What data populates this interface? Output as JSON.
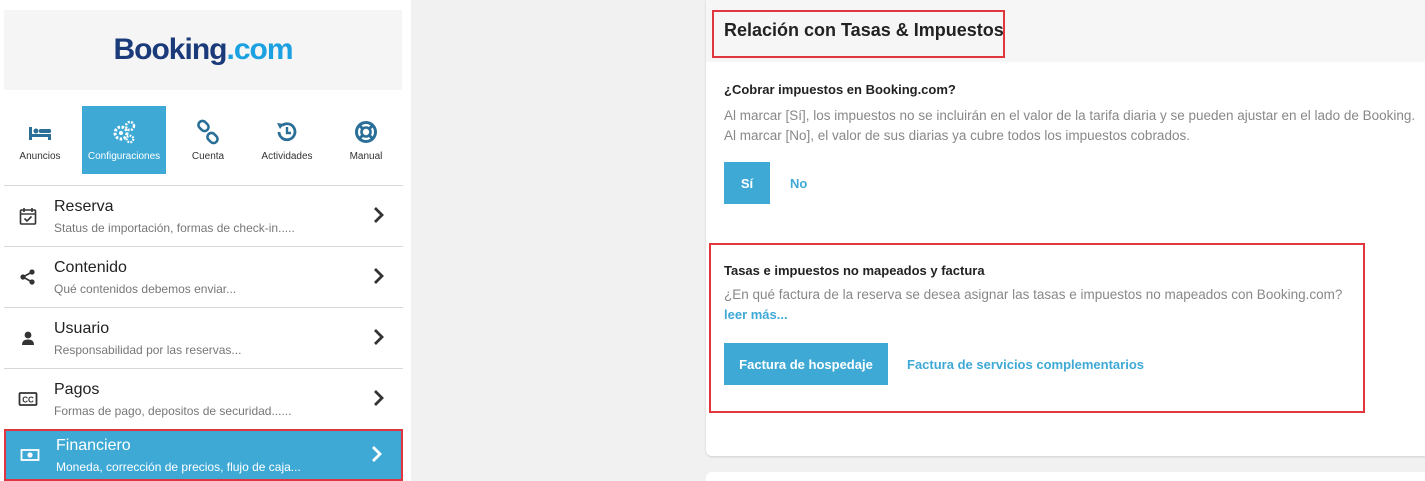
{
  "logo": {
    "brand": "Booking",
    "suffix": ".com"
  },
  "iconbar": [
    {
      "label": "Anuncios",
      "icon": "bed-icon"
    },
    {
      "label": "Configuraciones",
      "icon": "gears-icon"
    },
    {
      "label": "Cuenta",
      "icon": "link-icon"
    },
    {
      "label": "Actividades",
      "icon": "history-icon"
    },
    {
      "label": "Manual",
      "icon": "lifebuoy-icon"
    }
  ],
  "menu": [
    {
      "title": "Reserva",
      "subtitle": "Status de importación, formas de check-in.....",
      "icon": "calendar-check-icon"
    },
    {
      "title": "Contenido",
      "subtitle": "Qué contenidos debemos enviar...",
      "icon": "share-icon"
    },
    {
      "title": "Usuario",
      "subtitle": "Responsabilidad por las reservas...",
      "icon": "user-icon"
    },
    {
      "title": "Pagos",
      "subtitle": "Formas de pago, depositos de securidad......",
      "icon": "cc-icon"
    },
    {
      "title": "Financiero",
      "subtitle": "Moneda, corrección de precios, flujo de caja...",
      "icon": "money-icon"
    }
  ],
  "panel": {
    "title": "Relación con Tasas & Impuestos",
    "section1": {
      "question": "¿Cobrar impuestos en Booking.com?",
      "desc_line1": "Al marcar [Sí], los impuestos no se incluirán en el valor de la tarifa diaria y se pueden ajustar en el lado de Booking.",
      "desc_line2": "Al marcar [No], el valor de sus diarias ya cubre todos los impuestos cobrados.",
      "yes": "Sí",
      "no": "No"
    },
    "section2": {
      "question": "Tasas e impuestos no mapeados y factura",
      "desc": "¿En qué factura de la reserva se desea asignar las tasas e impuestos no mapeados con Booking.com?",
      "more": "leer más...",
      "option1": "Factura de hospedaje",
      "option2": "Factura de servicios complementarios"
    }
  },
  "colors": {
    "accent": "#3fa9d6",
    "highlight": "#e0363f",
    "brand": "#1b3a7a"
  }
}
